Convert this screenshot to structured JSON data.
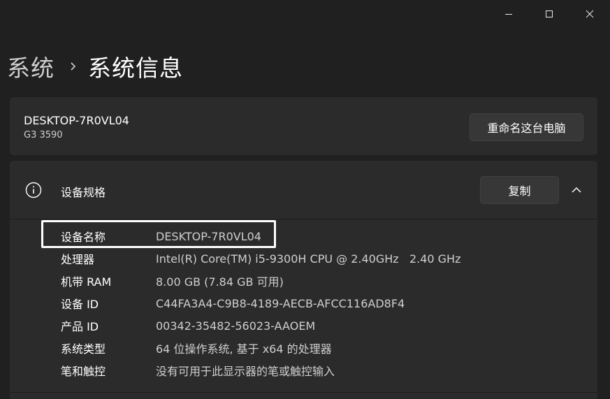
{
  "window": {
    "controls": {
      "minimize_icon": "minimize-icon",
      "maximize_icon": "maximize-icon",
      "close_icon": "close-icon"
    }
  },
  "breadcrumb": {
    "parent": "系统",
    "separator_icon": "chevron-right-icon",
    "current": "系统信息"
  },
  "device": {
    "name": "DESKTOP-7R0VL04",
    "model": "G3 3590",
    "rename_button": "重命名这台电脑"
  },
  "specs": {
    "title": "设备规格",
    "info_icon": "info-icon",
    "copy_button": "复制",
    "collapse_icon": "chevron-up-icon",
    "highlighted_row": "设备名称",
    "rows": [
      {
        "label": "设备名称",
        "value": "DESKTOP-7R0VL04"
      },
      {
        "label": "处理器",
        "value": "Intel(R) Core(TM) i5-9300H CPU @ 2.40GHz   2.40 GHz"
      },
      {
        "label": "机带 RAM",
        "value": "8.00 GB (7.84 GB 可用)"
      },
      {
        "label": "设备 ID",
        "value": "C44FA3A4-C9B8-4189-AECB-AFCC116AD8F4"
      },
      {
        "label": "产品 ID",
        "value": "00342-35482-56023-AAOEM"
      },
      {
        "label": "系统类型",
        "value": "64 位操作系统, 基于 x64 的处理器"
      },
      {
        "label": "笔和触控",
        "value": "没有可用于此显示器的笔或触控输入"
      }
    ]
  },
  "colors": {
    "background": "#202020",
    "card": "#2b2b2b",
    "button": "#373737",
    "highlight": "#ffffff"
  }
}
